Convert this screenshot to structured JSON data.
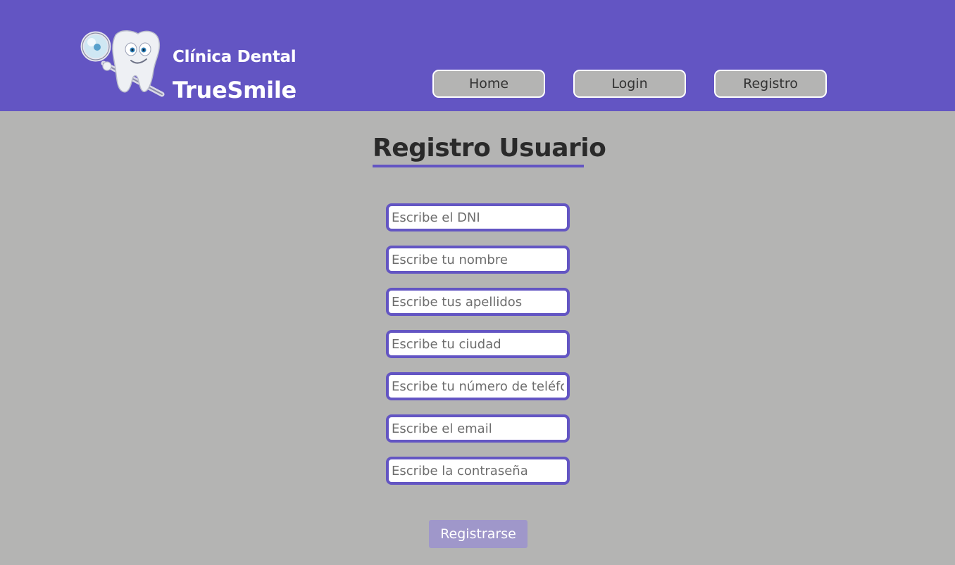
{
  "brand": {
    "line1": "Clínica Dental",
    "line2": "TrueSmile",
    "logo_icon": "tooth-mascot-icon"
  },
  "nav": {
    "home": "Home",
    "login": "Login",
    "registro": "Registro"
  },
  "page": {
    "title": "Registro Usuario"
  },
  "form": {
    "dni_placeholder": "Escribe el DNI",
    "nombre_placeholder": "Escribe tu nombre",
    "apellidos_placeholder": "Escribe tus apellidos",
    "ciudad_placeholder": "Escribe tu ciudad",
    "telefono_placeholder": "Escribe tu número de teléfono",
    "email_placeholder": "Escribe el email",
    "password_placeholder": "Escribe la contraseña",
    "submit_label": "Registrarse"
  },
  "colors": {
    "accent": "#6355c3",
    "background": "#b4b4b3",
    "submit_bg": "#9f97ca",
    "text_white": "#ffffff"
  }
}
